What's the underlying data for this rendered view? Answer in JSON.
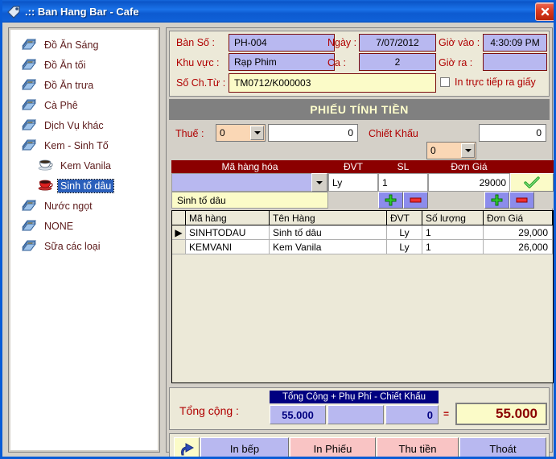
{
  "window": {
    "title": ".::  Ban Hang Bar  - Cafe",
    "title_icon": "tag-icon",
    "close_label": "close-icon"
  },
  "sidebar": {
    "items": [
      {
        "label": "Đồ Ăn Sáng",
        "icon": "folder-docs-icon",
        "child": false,
        "selected": false
      },
      {
        "label": "Đồ Ăn tối",
        "icon": "folder-docs-icon",
        "child": false,
        "selected": false
      },
      {
        "label": "Đồ Ăn trưa",
        "icon": "folder-docs-icon",
        "child": false,
        "selected": false
      },
      {
        "label": "Cà Phê",
        "icon": "folder-docs-icon",
        "child": false,
        "selected": false
      },
      {
        "label": "Dịch Vụ khác",
        "icon": "folder-docs-icon",
        "child": false,
        "selected": false
      },
      {
        "label": "Kem - Sinh Tố",
        "icon": "folder-docs-icon",
        "child": false,
        "selected": false
      },
      {
        "label": "Kem Vanila",
        "icon": "white-coffee-cup-icon",
        "child": true,
        "selected": false
      },
      {
        "label": "Sinh tố dâu",
        "icon": "red-coffee-cup-icon",
        "child": true,
        "selected": true
      },
      {
        "label": "Nước ngọt",
        "icon": "folder-docs-icon",
        "child": false,
        "selected": false
      },
      {
        "label": "NONE",
        "icon": "folder-docs-icon",
        "child": false,
        "selected": false
      },
      {
        "label": "Sữa các loại",
        "icon": "folder-docs-icon",
        "child": false,
        "selected": false
      }
    ]
  },
  "header": {
    "table_label": "Bàn Số :",
    "table_value": "PH-004",
    "area_label": "Khu vực :",
    "area_value": "Rạp Phim",
    "doc_label": "Số Ch.Từ :",
    "doc_value": "TM0712/K000003",
    "date_label": "Ngày :",
    "date_value": "7/07/2012",
    "shift_label": "Ca :",
    "shift_value": "2",
    "time_in_label": "Giờ vào :",
    "time_in_value": "4:30:09 PM",
    "time_out_label": "Giờ ra :",
    "time_out_value": "",
    "print_direct_label": "In trực tiếp ra giấy",
    "print_direct_checked": false
  },
  "section": {
    "title": "PHIẾU TÍNH TIỀN"
  },
  "tax": {
    "label": "Thuế :",
    "combo_value": "0",
    "amount": "0",
    "discount_label": "Chiết Khấu",
    "discount_combo_value": "0",
    "discount_amount": "0"
  },
  "entry": {
    "headers": [
      "Mã hàng hóa",
      "ĐVT",
      "SL",
      "Đơn Giá"
    ],
    "code_value": "",
    "unit_value": "Ly",
    "qty_value": "1",
    "price_value": "29000",
    "confirm_icon": "green-check-icon",
    "item_name": "Sinh tố dâu",
    "qty_plus_icon": "plus-icon",
    "qty_minus_icon": "minus-icon",
    "price_plus_icon": "plus-icon",
    "price_minus_icon": "minus-icon"
  },
  "grid": {
    "columns": [
      "",
      "Mã hàng",
      "Tên Hàng",
      "ĐVT",
      "Số lượng",
      "Đơn Giá"
    ],
    "rows": [
      {
        "indicator": "▶",
        "code": "SINHTODAU",
        "name": "Sinh tố dâu",
        "unit": "Ly",
        "qty": "1",
        "price": "29,000"
      },
      {
        "indicator": "",
        "code": "KEMVANI",
        "name": "Kem Vanila",
        "unit": "Ly",
        "qty": "1",
        "price": "26,000"
      }
    ]
  },
  "totals": {
    "label": "Tổng cộng :",
    "caption": "Tổng Cộng  + Phụ Phí - Chiết Khấu",
    "subtotal": "55.000",
    "surcharge": "",
    "discount": "0",
    "equals": "=",
    "grand_total": "55.000"
  },
  "buttons": {
    "refresh_icon": "redo-arrow-icon",
    "print_kitchen": "In bếp",
    "print_bill": "In Phiếu",
    "collect": "Thu tiền",
    "exit": "Thoát"
  },
  "colors": {
    "titlebar": "#0b55c8",
    "accent_red": "#8b0000",
    "label_red": "#b00000",
    "field_blue": "#b8b8f0",
    "field_yellow": "#fbfbc8",
    "combo_peach": "#fad7b5",
    "section_gray": "#808080",
    "navy": "#000080"
  }
}
